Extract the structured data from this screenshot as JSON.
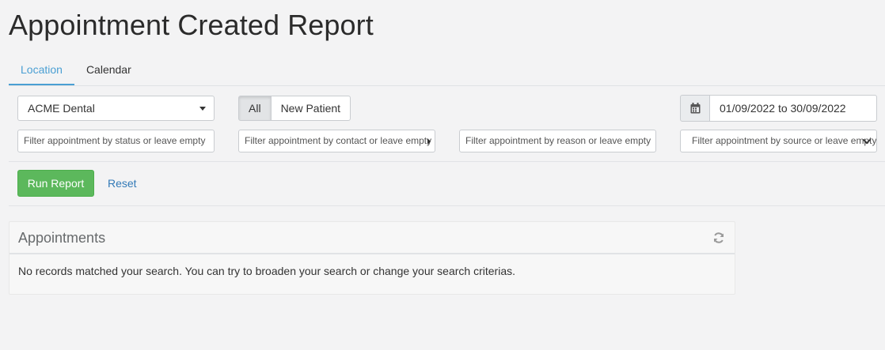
{
  "page": {
    "title": "Appointment Created Report"
  },
  "tabs": [
    {
      "label": "Location",
      "active": true
    },
    {
      "label": "Calendar",
      "active": false
    }
  ],
  "filters": {
    "location_select": "ACME Dental",
    "patient_toggle": {
      "all": "All",
      "new_patient": "New Patient",
      "selected": "All"
    },
    "date_range": "01/09/2022 to 30/09/2022",
    "status_placeholder": "Filter appointment by status or leave empty",
    "contact_placeholder": "Filter appointment by contact or leave empty",
    "reason_placeholder": "Filter appointment by reason or leave empty",
    "source_placeholder": "Filter appointment by source or leave empty"
  },
  "actions": {
    "run_report": "Run Report",
    "reset": "Reset"
  },
  "appointments_panel": {
    "title": "Appointments",
    "empty_message": "No records matched your search. You can try to broaden your search or change your search criterias."
  },
  "colors": {
    "accent": "#4a9fd3",
    "run_button": "#5cb85c",
    "link": "#337ab7"
  },
  "icons": {
    "date": "calendar-icon",
    "refresh": "refresh-icon",
    "dropdown": "chevron-down-icon"
  }
}
